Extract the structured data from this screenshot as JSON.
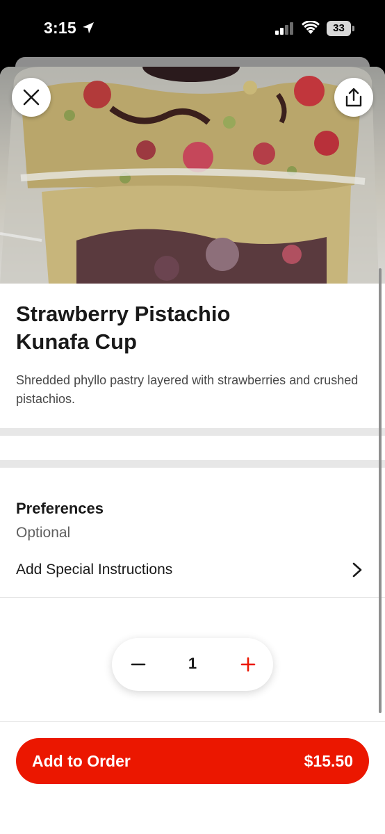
{
  "status_bar": {
    "time": "3:15",
    "battery": "33",
    "icons": [
      "location-arrow-icon",
      "cellular-signal-icon",
      "wifi-icon",
      "battery-icon"
    ]
  },
  "header": {
    "close_icon": "close-icon",
    "share_icon": "share-icon"
  },
  "item": {
    "title": "Strawberry Pistachio Kunafa Cup",
    "description": "Shredded phyllo pastry layered with strawberries and crushed pistachios."
  },
  "preferences": {
    "title": "Preferences",
    "subtitle": "Optional",
    "instructions_label": "Add Special Instructions"
  },
  "quantity": {
    "value": "1",
    "minus_icon": "minus-icon",
    "plus_icon": "plus-icon"
  },
  "cta": {
    "label": "Add to Order",
    "price": "$15.50"
  },
  "colors": {
    "accent": "#eb1700",
    "text_primary": "#191919",
    "text_secondary": "#494949"
  }
}
